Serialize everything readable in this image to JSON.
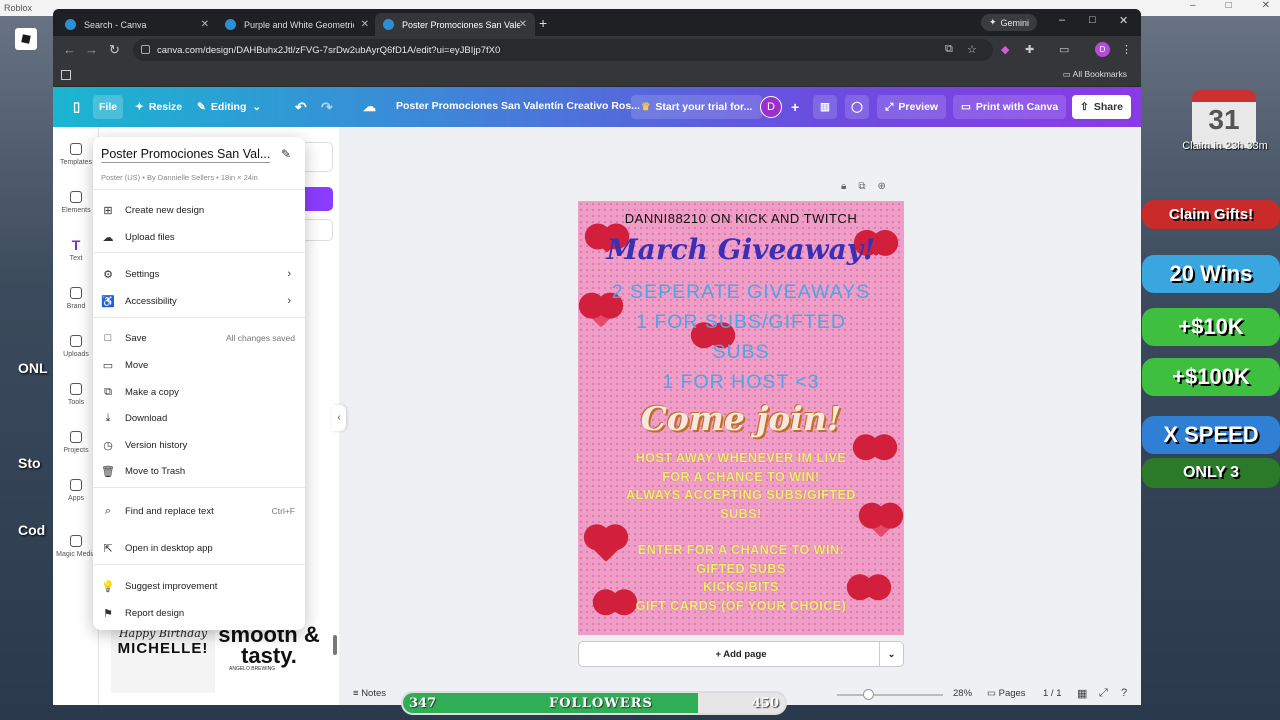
{
  "roblox": {
    "title": "Roblox",
    "calendar_day": "31",
    "claim_text": "Claim in 23h 33m",
    "pills": [
      "Claim Gifts!",
      "20 Wins",
      "+$10K",
      "+$100K",
      "X SPEED",
      "ONLY 3"
    ],
    "left_labels": [
      "ONL",
      "Sto",
      "Cod"
    ]
  },
  "browser": {
    "tabs": [
      {
        "label": "Search - Canva"
      },
      {
        "label": "Purple and White Geometric Bu"
      },
      {
        "label": "Poster Promociones San Valentín"
      }
    ],
    "gemini_label": "Gemini",
    "url": "canva.com/design/DAHBuhx2Jtl/zFVG-7srDw2ubAyrQ6fD1A/edit?ui=eyJBIjp7fX0",
    "profile_initial": "D",
    "all_bookmarks": "All Bookmarks"
  },
  "canva": {
    "header": {
      "file": "File",
      "resize": "Resize",
      "editing": "Editing",
      "title": "Poster Promociones San Valentín Creativo Ros...",
      "trial": "Start your trial for...",
      "avatar": "D",
      "preview": "Preview",
      "print": "Print with Canva",
      "share": "Share"
    },
    "rail": [
      "Templates",
      "Elements",
      "Text",
      "Brand",
      "Uploads",
      "Tools",
      "Projects",
      "Apps",
      "Magic Media"
    ],
    "file_menu": {
      "title": "Poster Promociones San Val...",
      "subtitle": "Poster (US) • By Dannielle Sellers • 18in × 24in",
      "items": [
        {
          "label": "Create new design"
        },
        {
          "label": "Upload files"
        },
        {
          "label": "Settings"
        },
        {
          "label": "Accessibility"
        },
        {
          "label": "Save",
          "meta": "All changes saved"
        },
        {
          "label": "Move"
        },
        {
          "label": "Make a copy"
        },
        {
          "label": "Download"
        },
        {
          "label": "Version history"
        },
        {
          "label": "Move to Trash"
        },
        {
          "label": "Find and replace text",
          "meta": "Ctrl+F"
        },
        {
          "label": "Open in desktop app"
        },
        {
          "label": "Suggest improvement"
        },
        {
          "label": "Report design"
        }
      ]
    },
    "thumbs": {
      "t1_a": "Happy Birthday",
      "t1_b": "MICHELLE!",
      "t2_a": "smooth & tasty.",
      "t2_b": "ANGELO BREWING"
    },
    "poster": {
      "line1": "DANNI88210 ON KICK AND TWITCH",
      "line2": "March Giveaway!",
      "line3a": "2 SEPERATE GIVEAWAYS",
      "line3b": "1 FOR SUBS/GIFTED",
      "line3c": "SUBS",
      "line3d": "1 FOR HOST <3",
      "line4": "Come join!",
      "line5a": "HOST AWAY WHENEVER IM LIVE",
      "line5b": "FOR A CHANCE TO WIN!",
      "line5c": "ALWAYS ACCEPTING SUBS/GIFTED",
      "line5d": "SUBS!",
      "line6a": "ENTER FOR A CHANCE TO WIN:",
      "line6b": "GIFTED SUBS",
      "line6c": "KICKS/BITS",
      "line6d": "GIFT CARDS (OF YOUR CHOICE)"
    },
    "add_page": "+ Add page",
    "footer": {
      "notes": "Notes",
      "zoom": "28%",
      "pages": "Pages",
      "page_count": "1 / 1"
    }
  },
  "followers": {
    "current": "347",
    "label": "FOLLOWERS",
    "goal": "450",
    "progress": 0.771
  }
}
